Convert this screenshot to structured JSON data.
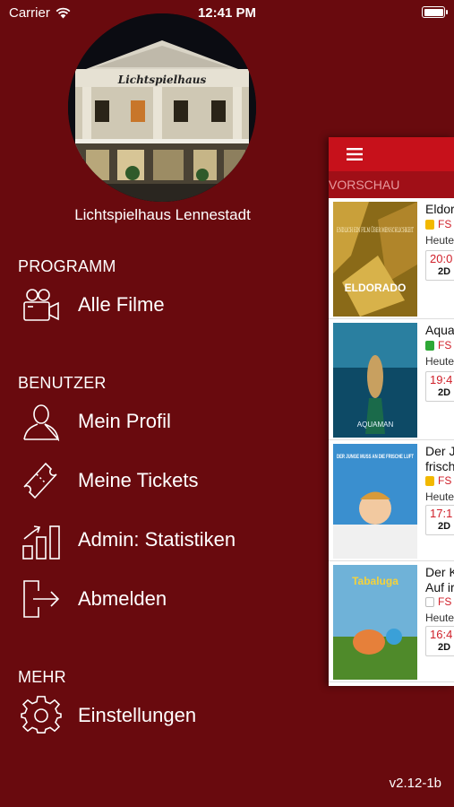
{
  "status_bar": {
    "carrier": "Carrier",
    "time": "12:41 PM"
  },
  "cinema": {
    "photo_sign": "Lichtspielhaus",
    "name": "Lichtspielhaus Lennestadt"
  },
  "menu": {
    "programm": {
      "header": "PROGRAMM",
      "items": [
        {
          "label": "Alle Filme",
          "icon": "video-camera-icon"
        }
      ]
    },
    "benutzer": {
      "header": "BENUTZER",
      "items": [
        {
          "label": "Mein Profil",
          "icon": "person-icon"
        },
        {
          "label": "Meine Tickets",
          "icon": "ticket-icon"
        },
        {
          "label": "Admin: Statistiken",
          "icon": "bar-chart-icon"
        },
        {
          "label": "Abmelden",
          "icon": "logout-icon"
        }
      ]
    },
    "mehr": {
      "header": "MEHR",
      "items": [
        {
          "label": "Einstellungen",
          "icon": "gear-icon"
        }
      ]
    }
  },
  "version": "v2.12-1b",
  "panel": {
    "nav_icon": "hamburger-menu-icon",
    "tab": "VORSCHAU",
    "movies": [
      {
        "title_lines": [
          "Eldor"
        ],
        "fsk": "FS",
        "fsk_color": "#f2b800",
        "day": "Heute",
        "time": "20:0",
        "format": "2D",
        "poster_title": "ELDORADO",
        "poster_text": "ENDLICH EIN FILM ÜBER MENSCHLICHKEIT"
      },
      {
        "title_lines": [
          "Aqua"
        ],
        "fsk": "FS",
        "fsk_color": "#2ea836",
        "day": "Heute",
        "time": "19:4",
        "format": "2D",
        "poster_title": "AQUAMAN"
      },
      {
        "title_lines": [
          "Der J",
          "frisch"
        ],
        "fsk": "FS",
        "fsk_color": "#f2b800",
        "day": "Heute",
        "time": "17:1",
        "format": "2D",
        "poster_title": "DER JUNGE MUSS AN DIE FRISCHE LUFT"
      },
      {
        "title_lines": [
          "Der K",
          "Auf ir"
        ],
        "fsk": "FS",
        "fsk_color": "#ffffff",
        "day": "Heute",
        "time": "16:4",
        "format": "2D",
        "poster_title": "Tabaluga"
      }
    ]
  }
}
